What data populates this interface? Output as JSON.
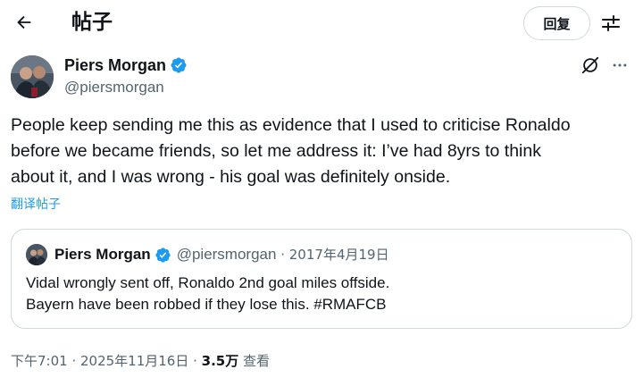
{
  "header": {
    "title": "帖子",
    "reply_label": "回复",
    "back_icon": "arrow-left-icon",
    "filter_icon": "sliders-icon"
  },
  "post": {
    "author_name": "Piers Morgan",
    "handle": "@piersmorgan",
    "text_lines": [
      "People keep sending me this as evidence that I used to criticise Ronaldo",
      "before we became friends, so let me address it: I’ve had 8yrs to think",
      "about it, and I was wrong - his goal was definitely onside."
    ],
    "translate_label": "翻译帖子"
  },
  "quote": {
    "author_name": "Piers Morgan",
    "handle": "@piersmorgan",
    "separator": " · ",
    "date": "2017年4月19日",
    "text_lines": [
      "Vidal wrongly sent off, Ronaldo 2nd goal miles offside.",
      "Bayern have been robbed if they lose this. #RMAFCB"
    ]
  },
  "meta": {
    "time": "下午7:01",
    "sep1": " · ",
    "date": "2025年11月16日",
    "sep2": " · ",
    "views_count": "3.5万",
    "views_label": " 查看"
  },
  "colors": {
    "text": "#0f1419",
    "secondary": "#536471",
    "link": "#1d9bf0",
    "border": "#cfd9de",
    "verified": "#1d9bf0"
  }
}
